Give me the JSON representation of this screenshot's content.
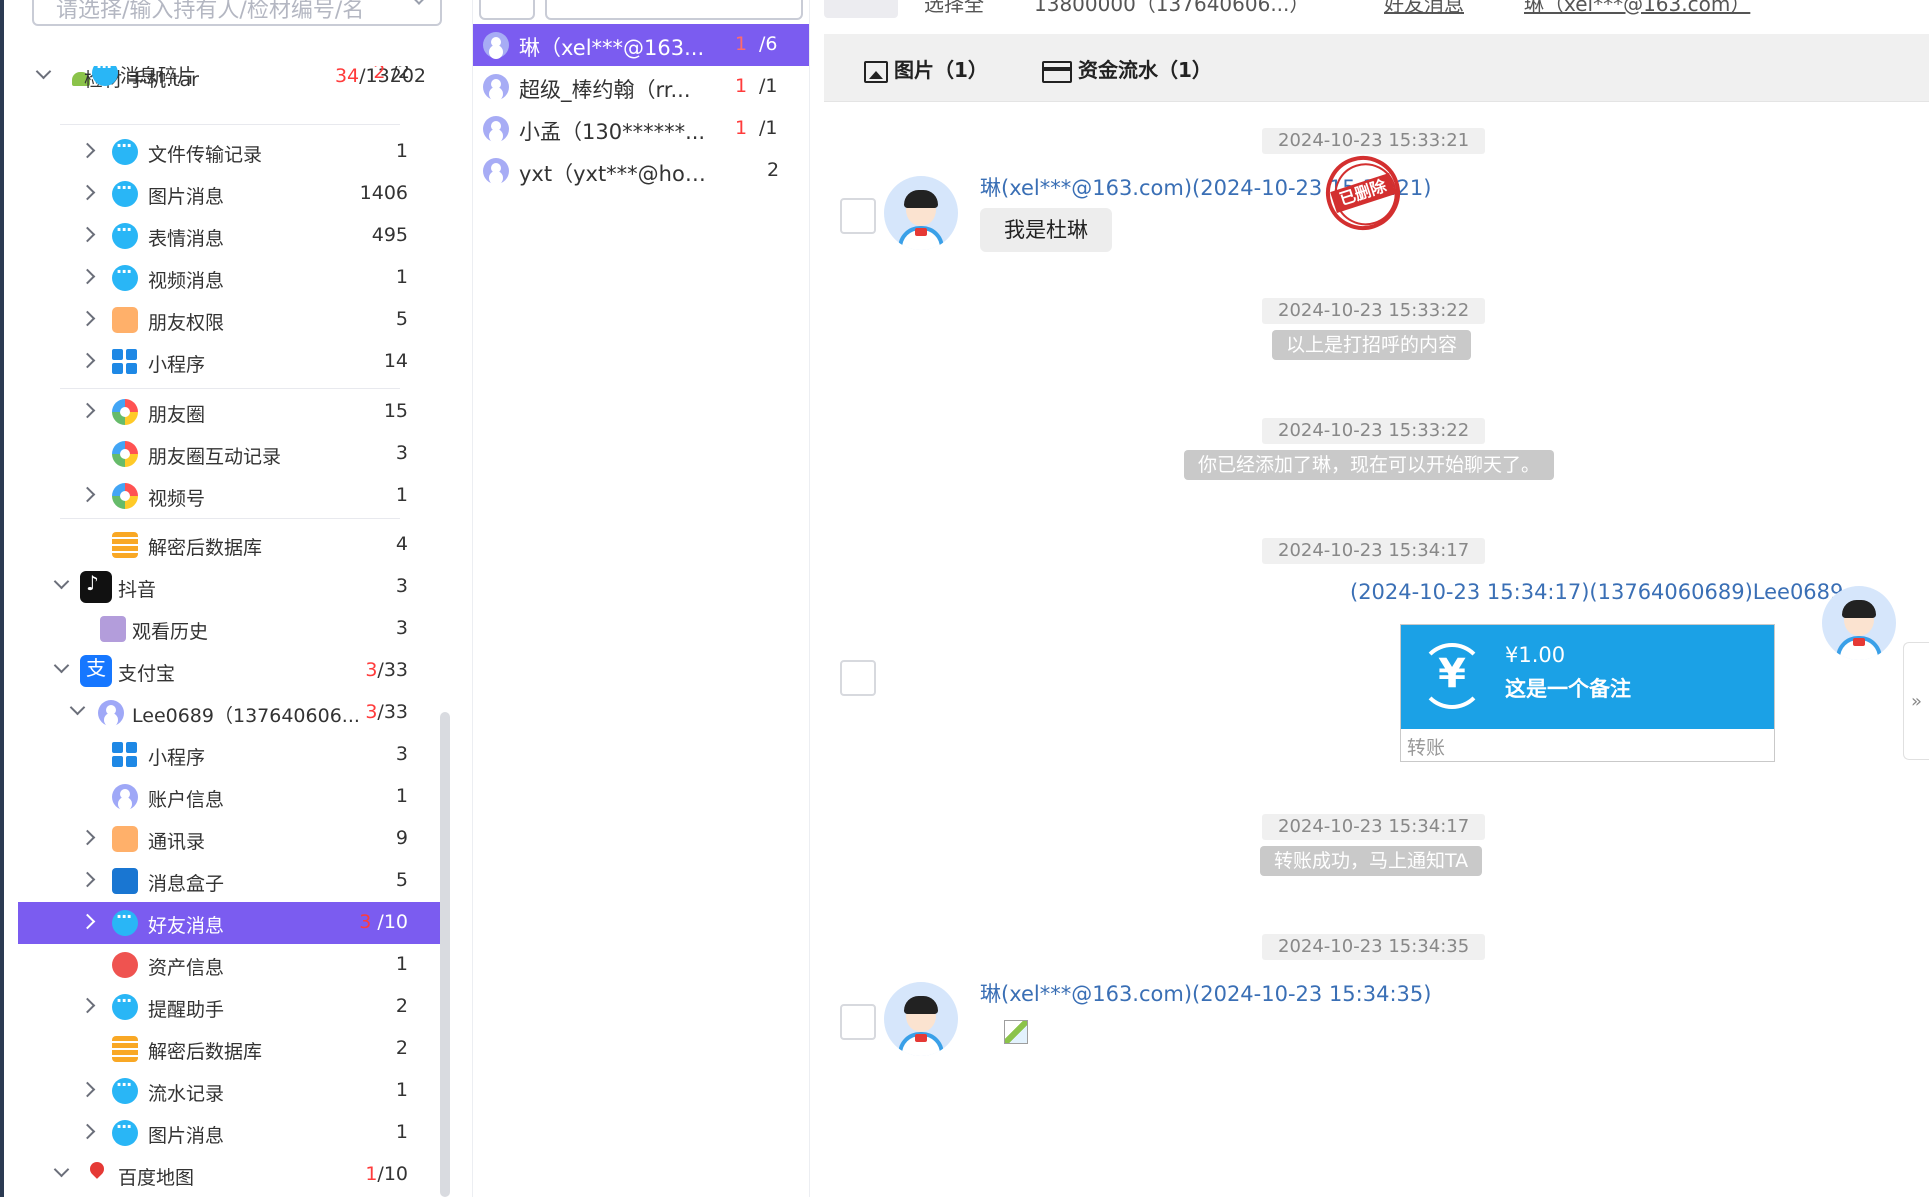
{
  "left": {
    "search_placeholder": "请选择/输入持有人/检材编号/名",
    "tree": [
      {
        "label": "检材 手机.tar",
        "count_red": "34",
        "count_rest": "/13202"
      },
      {
        "label": "消息碎片",
        "count_red": "2",
        "count_rest": "/2"
      },
      {
        "label": "文件传输记录",
        "count_rest": "1"
      },
      {
        "label": "图片消息",
        "count_rest": "1406"
      },
      {
        "label": "表情消息",
        "count_rest": "495"
      },
      {
        "label": "视频消息",
        "count_rest": "1"
      },
      {
        "label": "朋友权限",
        "count_rest": "5"
      },
      {
        "label": "小程序",
        "count_rest": "14"
      },
      {
        "label": "朋友圈",
        "count_rest": "15"
      },
      {
        "label": "朋友圈互动记录",
        "count_rest": "3"
      },
      {
        "label": "视频号",
        "count_rest": "1"
      },
      {
        "label": "解密后数据库",
        "count_rest": "4"
      },
      {
        "label": "抖音",
        "count_rest": "3"
      },
      {
        "label": "观看历史",
        "count_rest": "3"
      },
      {
        "label": "支付宝",
        "count_red": "3",
        "count_rest": "/33"
      },
      {
        "label": "Lee0689（137640606...",
        "count_red": "3",
        "count_rest": "/33"
      },
      {
        "label": "小程序",
        "count_rest": "3"
      },
      {
        "label": "账户信息",
        "count_rest": "1"
      },
      {
        "label": "通讯录",
        "count_rest": "9"
      },
      {
        "label": "消息盒子",
        "count_rest": "5"
      },
      {
        "label": "好友消息",
        "count_red": "3",
        "count_rest": " /10"
      },
      {
        "label": "资产信息",
        "count_rest": "1"
      },
      {
        "label": "提醒助手",
        "count_rest": "2"
      },
      {
        "label": "解密后数据库",
        "count_rest": "2"
      },
      {
        "label": "流水记录",
        "count_rest": "1"
      },
      {
        "label": "图片消息",
        "count_rest": "1"
      },
      {
        "label": "百度地图",
        "count_red": "1",
        "count_rest": "/10"
      }
    ]
  },
  "mid": {
    "search_placeholder": "搜索内容",
    "contacts": [
      {
        "name": "琳（xel***@163...",
        "unread": "1",
        "total": "/6"
      },
      {
        "name": "超级_棒约翰（rr...",
        "unread": "1",
        "total": "/1"
      },
      {
        "name": "小孟（130******...",
        "unread": "1",
        "total": "/1"
      },
      {
        "name": "yxt（yxt***@hotma...",
        "unread": "",
        "total": "2"
      }
    ]
  },
  "right": {
    "top_fragments": [
      "选择全",
      "13800000（137640606...）",
      "好友消息",
      "琳（xel***@163.com）"
    ],
    "tabs": [
      {
        "label": "图片（1）",
        "icon": "image-icon"
      },
      {
        "label": "资金流水（1）",
        "icon": "card-icon"
      }
    ],
    "messages": {
      "ts1": "2024-10-23 15:33:21",
      "sender1": "琳(xel***@163.com)(2024-10-23 15:33:21)",
      "bubble1": "我是杜琳",
      "stamp": "已删除",
      "ts2": "2024-10-23 15:33:22",
      "sys2": "以上是打招呼的内容",
      "ts3": "2024-10-23 15:33:22",
      "sys3": "你已经添加了琳，现在可以开始聊天了。",
      "ts4": "2024-10-23 15:34:17",
      "sender4": "(2024-10-23 15:34:17)(13764060689)Lee0689",
      "transfer_symbol": "¥",
      "transfer_amount": "¥1.00",
      "transfer_note": "这是一个备注",
      "transfer_type": "转账",
      "ts5": "2024-10-23 15:34:17",
      "sys5": "转账成功，马上通知TA",
      "ts6": "2024-10-23 15:34:35",
      "sender6": "琳(xel***@163.com)(2024-10-23 15:34:35)"
    },
    "side_toggle": "»"
  },
  "colors": {
    "selected": "#7b5cf0",
    "link": "#3a6fb5",
    "transfer": "#1ba1e6",
    "unread": "#ff3b3b"
  }
}
